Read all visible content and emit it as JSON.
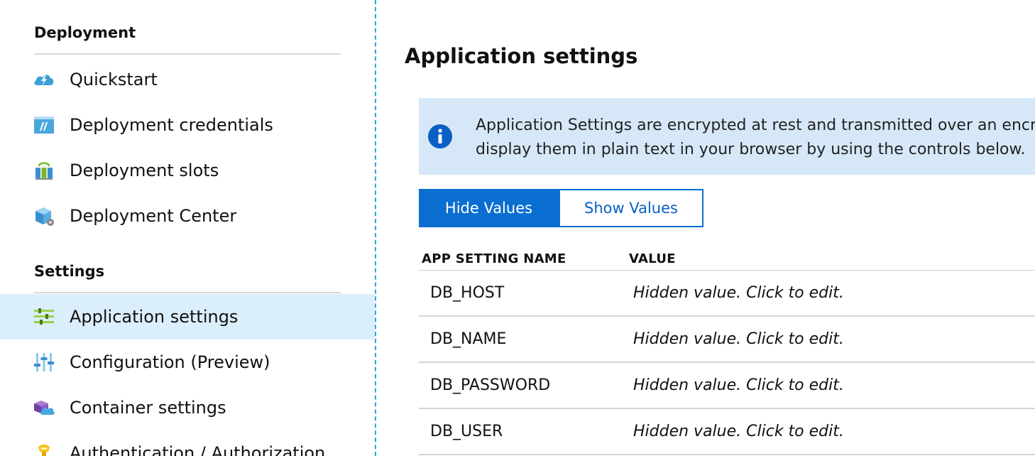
{
  "sidebar": {
    "sections": [
      {
        "header": "Deployment",
        "items": [
          {
            "label": "Quickstart",
            "icon": "cloud-lightning-icon"
          },
          {
            "label": "Deployment credentials",
            "icon": "credentials-icon"
          },
          {
            "label": "Deployment slots",
            "icon": "slots-icon"
          },
          {
            "label": "Deployment Center",
            "icon": "deployment-center-icon"
          }
        ]
      },
      {
        "header": "Settings",
        "items": [
          {
            "label": "Application settings",
            "icon": "sliders-icon",
            "selected": true
          },
          {
            "label": "Configuration (Preview)",
            "icon": "configuration-icon"
          },
          {
            "label": "Container settings",
            "icon": "container-icon"
          },
          {
            "label": "Authentication / Authorization",
            "icon": "key-icon"
          }
        ]
      }
    ]
  },
  "main": {
    "title": "Application settings",
    "info_banner": {
      "icon": "info-icon",
      "text": "Application Settings are encrypted at rest and transmitted over an encrypted channel. You can choose to display them in plain text in your browser by using the controls below."
    },
    "toggle": {
      "hide_label": "Hide Values",
      "show_label": "Show Values",
      "selected": "Hide Values"
    },
    "table": {
      "columns": [
        "APP SETTING NAME",
        "VALUE"
      ],
      "rows": [
        {
          "name": "DB_HOST",
          "value": "Hidden value. Click to edit."
        },
        {
          "name": "DB_NAME",
          "value": "Hidden value. Click to edit."
        },
        {
          "name": "DB_PASSWORD",
          "value": "Hidden value. Click to edit."
        },
        {
          "name": "DB_USER",
          "value": "Hidden value. Click to edit."
        }
      ]
    }
  },
  "colors": {
    "accent": "#0a6ed1",
    "selected_row": "#dbeefb",
    "banner_bg": "#d6e8f8",
    "divider": "#2aa6d8"
  }
}
